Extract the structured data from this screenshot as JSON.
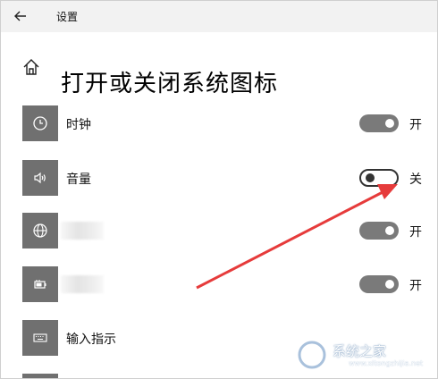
{
  "window": {
    "title": "设置"
  },
  "header": {
    "title": "打开或关闭系统图标"
  },
  "items": [
    {
      "label": "时钟",
      "icon": "clock-icon",
      "state": "on",
      "state_label": "开"
    },
    {
      "label": "音量",
      "icon": "volume-icon",
      "state": "off",
      "state_label": "关"
    },
    {
      "label": "",
      "icon": "globe-icon",
      "state": "on",
      "state_label": "开",
      "blurred": true
    },
    {
      "label": "",
      "icon": "battery-icon",
      "state": "on",
      "state_label": "开",
      "blurred": true
    },
    {
      "label": "输入指示",
      "icon": "keyboard-icon"
    }
  ],
  "colors": {
    "tile": "#707070",
    "toggle_on": "#7a7a7a",
    "arrow": "#e63b3b"
  },
  "watermark": {
    "text": "系统之家",
    "url": "www.xitongzhijia.net"
  }
}
